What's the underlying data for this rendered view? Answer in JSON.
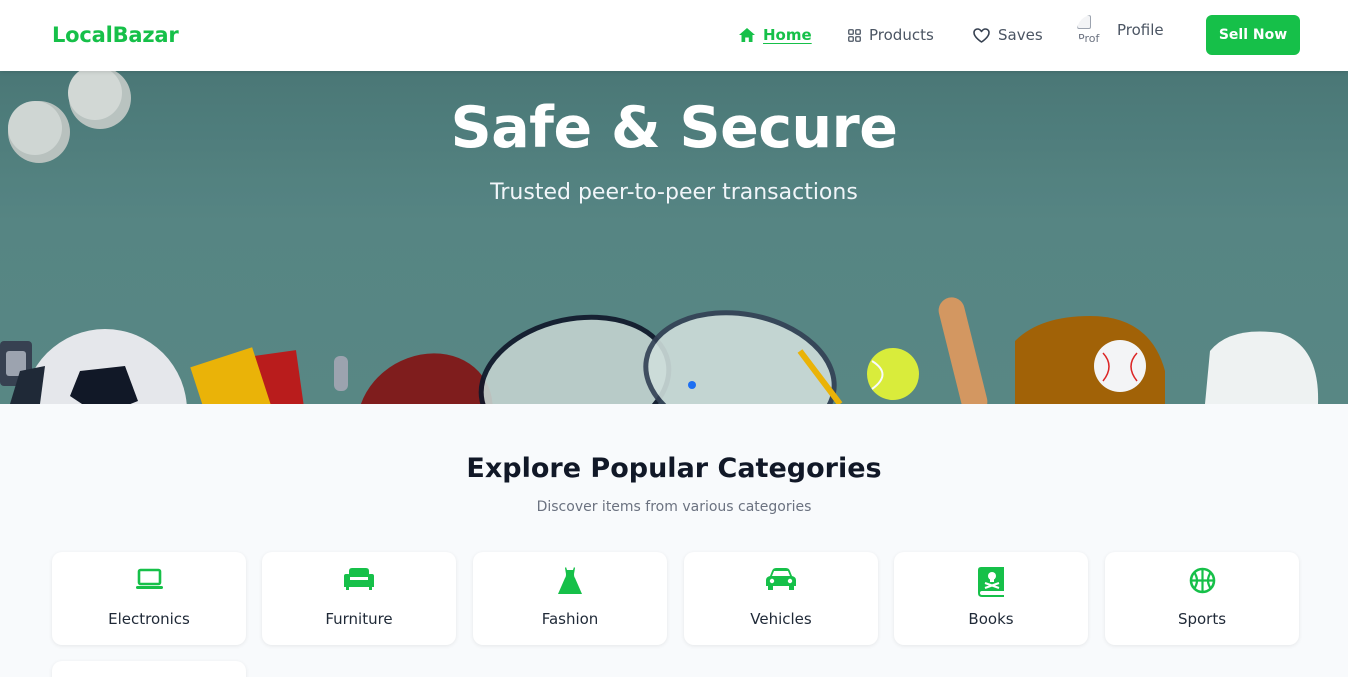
{
  "brand": {
    "name": "LocalBazar",
    "accent": "#16c049"
  },
  "nav": {
    "home": "Home",
    "products": "Products",
    "saves": "Saves",
    "profile": "Profile",
    "profile_avatar_alt": "Prof",
    "sell_button": "Sell Now"
  },
  "hero": {
    "title": "Safe & Secure",
    "subtitle": "Trusted peer-to-peer transactions"
  },
  "categories": {
    "title": "Explore Popular Categories",
    "subtitle": "Discover items from various categories",
    "items": [
      {
        "label": "Electronics",
        "icon": "laptop-icon"
      },
      {
        "label": "Furniture",
        "icon": "couch-icon"
      },
      {
        "label": "Fashion",
        "icon": "dress-icon"
      },
      {
        "label": "Vehicles",
        "icon": "car-icon"
      },
      {
        "label": "Books",
        "icon": "book-icon"
      },
      {
        "label": "Sports",
        "icon": "basketball-icon"
      }
    ]
  }
}
